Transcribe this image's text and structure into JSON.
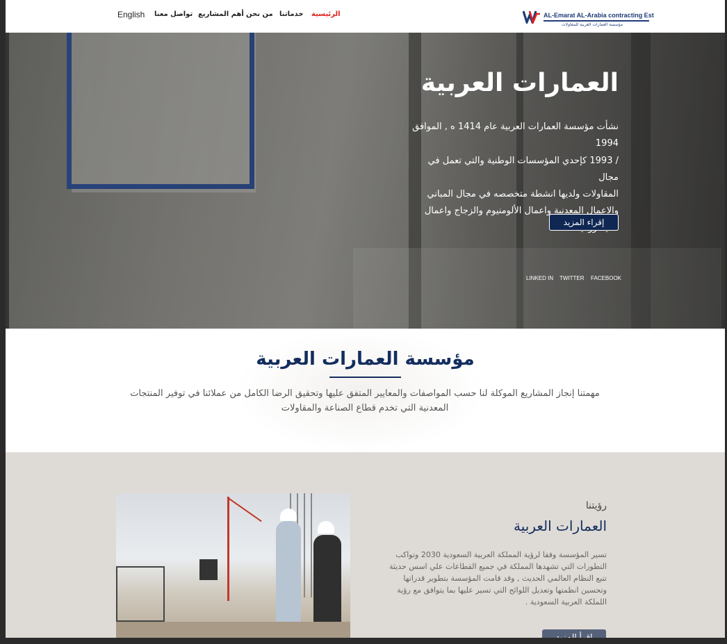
{
  "navbar": {
    "logo_text_en": "AL-Emarat AL-Arabia contracting Est",
    "logo_text_ar": "مؤسسة العمارات العربية للمقاولات",
    "items": [
      {
        "label": "الرئيسية",
        "active": true
      },
      {
        "label": "خدماتنا"
      },
      {
        "label": "من نحن"
      },
      {
        "label": "أهم المشاريع"
      },
      {
        "label": "تواصل معنا"
      }
    ],
    "language": "English",
    "accent_color": "#e2231a"
  },
  "hero": {
    "title": "العمارات العربية",
    "lines": [
      "نشأت مؤسسة العمارات العربية عام 1414 ه , الموافق 1994",
      "/ 1993 كإحدي المؤسسات الوطنية والتي تعمل في مجال",
      "المقاولات  ولديها انشطة متخصصه في مجال المباني",
      "والاعمال المعدنية واعمال الألومنيوم  والزجاج واعمال",
      "الاليكتروميكانك"
    ],
    "button": "إقراء المزيد",
    "social": [
      "LINKED IN",
      "TWITTER",
      "FACEBOOK"
    ]
  },
  "intro": {
    "title": "مؤسسة العمارات العربية",
    "text_line1": "مهمتنا إنجاز المشاريع الموكلة لنا حسب المواصفات والمعايير المتفق عليها وتحقيق الرضا الكامل من عملائنا في توفير المنتجات",
    "text_line2": "المعدنية التي تخدم قطاع الصناعة والمقاولات"
  },
  "vision": {
    "subtitle": "رؤيتنا",
    "title": "العمارات العربية",
    "lines": [
      "تسير المؤسسة وفقا لرؤية المملكة العربية السعودية 2030 وتواكب",
      "التطورات التي تشهدها المملكة في جميع القطاعات علي اسس حديثة",
      "تتبع النظام العالمي الحديث , وقد قامت المؤسسة بتطوير قدراتها",
      "وتحسين انظمتها وتعديل اللوائح التي تسير عليها بما يتوافق مع رؤية",
      "اللملكة العربية السعودية ."
    ],
    "button": "إقرأ المزيد"
  },
  "colors": {
    "brand_navy": "#132d5e",
    "button_navy": "#0f2752",
    "vision_bg": "#dedad5"
  }
}
